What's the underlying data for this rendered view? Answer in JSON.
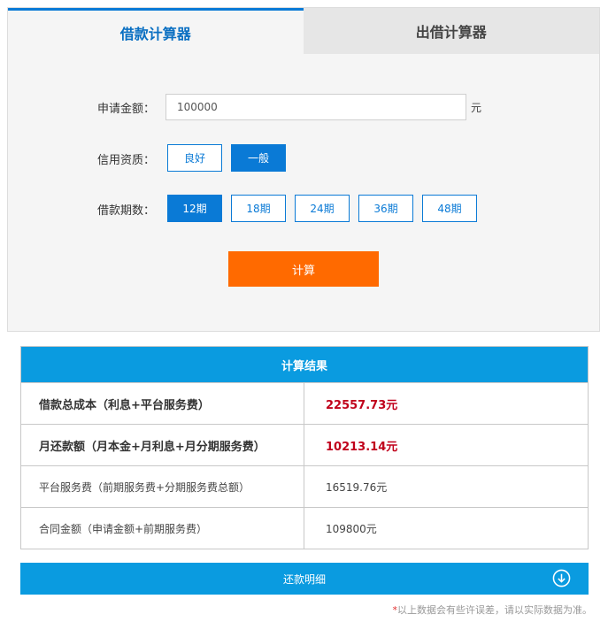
{
  "tabs": [
    {
      "label": "借款计算器",
      "active": true
    },
    {
      "label": "出借计算器",
      "active": false
    }
  ],
  "form": {
    "amount_label": "申请金额：",
    "amount_value": "100000",
    "amount_unit": "元",
    "credit_label": "信用资质：",
    "credit_options": [
      "良好",
      "一般"
    ],
    "credit_selected": "一般",
    "term_label": "借款期数：",
    "term_options": [
      "12期",
      "18期",
      "24期",
      "36期",
      "48期"
    ],
    "term_selected": "12期",
    "calc_button": "计算"
  },
  "results": {
    "title": "计算结果",
    "rows": [
      {
        "label": "借款总成本（利息+平台服务费）",
        "value": "22557.73元"
      },
      {
        "label": "月还款额（月本金+月利息+月分期服务费）",
        "value": "10213.14元"
      },
      {
        "label": "平台服务费（前期服务费+分期服务费总额）",
        "value": "16519.76元"
      },
      {
        "label": "合同金额（申请金额+前期服务费）",
        "value": "109800元"
      }
    ]
  },
  "detail": {
    "label": "还款明细",
    "icon": "arrow-down-circle-icon"
  },
  "note": {
    "star": "*",
    "text": "以上数据会有些许误差，请以实际数据为准。"
  },
  "colors": {
    "primary": "#0a7ad6",
    "header_blue": "#0a9be0",
    "calc_orange": "#ff6a00",
    "value_red": "#c0001b"
  }
}
